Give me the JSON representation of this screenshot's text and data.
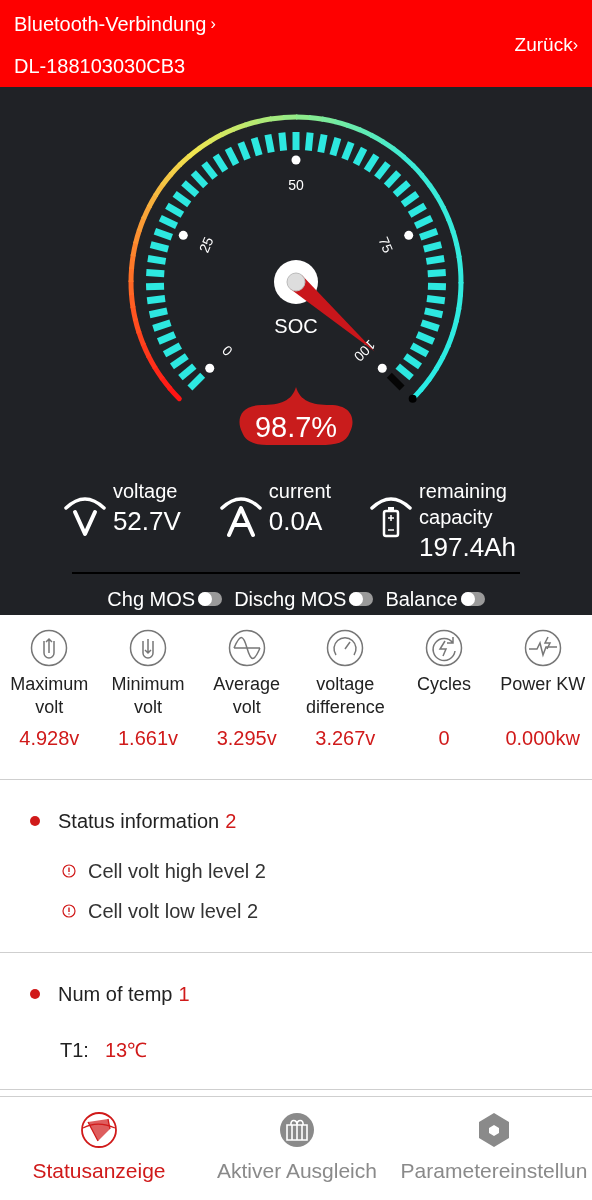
{
  "header": {
    "connection": "Bluetooth-Verbindung",
    "connection_arrow": "›",
    "device": "DL-188103030CB3",
    "back": "Zurück",
    "back_arrow": "›"
  },
  "gauge": {
    "label": "SOC",
    "scale": [
      "0",
      "25",
      "50",
      "75",
      "100"
    ],
    "value": "98.7%"
  },
  "readings": [
    {
      "kind": "voltage",
      "label": "voltage",
      "value": "52.7V"
    },
    {
      "kind": "current",
      "label": "current",
      "value": "0.0A"
    },
    {
      "kind": "capacity",
      "label": "remaining capacity",
      "value": "197.4Ah"
    }
  ],
  "switches": [
    {
      "label": "Chg MOS",
      "on": false
    },
    {
      "label": "Dischg MOS",
      "on": false
    },
    {
      "label": "Balance",
      "on": false
    }
  ],
  "stats": [
    {
      "kind": "max",
      "label": "Maximum volt",
      "value": "4.928v"
    },
    {
      "kind": "min",
      "label": "Minimum volt",
      "value": "1.661v"
    },
    {
      "kind": "avg",
      "label": "Average volt",
      "value": "3.295v"
    },
    {
      "kind": "diff",
      "label": "voltage difference",
      "value": "3.267v"
    },
    {
      "kind": "cycles",
      "label": "Cycles",
      "value": "0"
    },
    {
      "kind": "power",
      "label": "Power KW",
      "value": "0.000kw"
    }
  ],
  "status": {
    "title": "Status information",
    "count": "2",
    "items": [
      "Cell volt high level 2",
      "Cell volt low level 2"
    ]
  },
  "temps": {
    "title": "Num of temp",
    "count": "1",
    "items": [
      {
        "name": "T1:",
        "value": "13℃"
      }
    ]
  },
  "tabs": [
    {
      "kind": "status",
      "label": "Statusanzeige",
      "selected": true
    },
    {
      "kind": "balance",
      "label": "Aktiver Ausgleich",
      "selected": false
    },
    {
      "kind": "params",
      "label": "Parametereinstellun",
      "selected": false
    }
  ]
}
